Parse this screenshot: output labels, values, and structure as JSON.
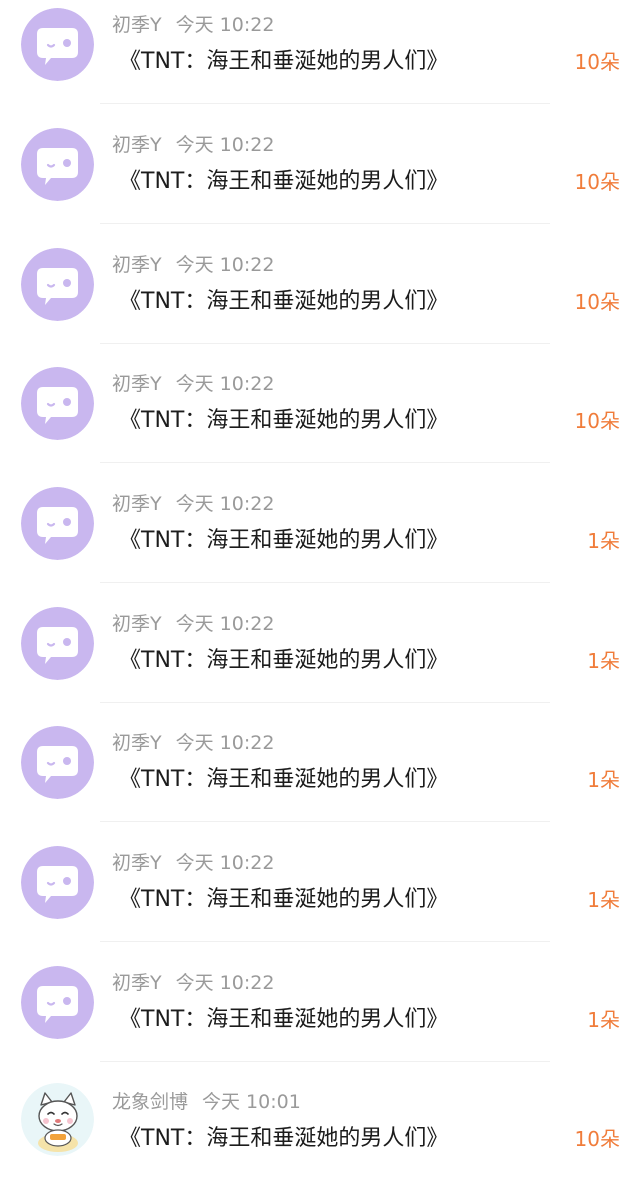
{
  "colors": {
    "avatar_purple": "#c9b7ef",
    "amount_orange": "#f07c3a",
    "meta_gray": "#9a9a9a",
    "title_black": "#1c1c1c"
  },
  "gifts": [
    {
      "user": "初季Y",
      "time": "今天 10:22",
      "title": "《TNT：海王和垂涎她的男人们》",
      "amount": "10朵",
      "avatar": "chat-bubble-icon"
    },
    {
      "user": "初季Y",
      "time": "今天 10:22",
      "title": "《TNT：海王和垂涎她的男人们》",
      "amount": "10朵",
      "avatar": "chat-bubble-icon"
    },
    {
      "user": "初季Y",
      "time": "今天 10:22",
      "title": "《TNT：海王和垂涎她的男人们》",
      "amount": "10朵",
      "avatar": "chat-bubble-icon"
    },
    {
      "user": "初季Y",
      "time": "今天 10:22",
      "title": "《TNT：海王和垂涎她的男人们》",
      "amount": "10朵",
      "avatar": "chat-bubble-icon"
    },
    {
      "user": "初季Y",
      "time": "今天 10:22",
      "title": "《TNT：海王和垂涎她的男人们》",
      "amount": "1朵",
      "avatar": "chat-bubble-icon"
    },
    {
      "user": "初季Y",
      "time": "今天 10:22",
      "title": "《TNT：海王和垂涎她的男人们》",
      "amount": "1朵",
      "avatar": "chat-bubble-icon"
    },
    {
      "user": "初季Y",
      "time": "今天 10:22",
      "title": "《TNT：海王和垂涎她的男人们》",
      "amount": "1朵",
      "avatar": "chat-bubble-icon"
    },
    {
      "user": "初季Y",
      "time": "今天 10:22",
      "title": "《TNT：海王和垂涎她的男人们》",
      "amount": "1朵",
      "avatar": "chat-bubble-icon"
    },
    {
      "user": "初季Y",
      "time": "今天 10:22",
      "title": "《TNT：海王和垂涎她的男人们》",
      "amount": "1朵",
      "avatar": "chat-bubble-icon"
    },
    {
      "user": "龙象剑博",
      "time": "今天 10:01",
      "title": "《TNT：海王和垂涎她的男人们》",
      "amount": "10朵",
      "avatar": "cartoon-cat-avatar"
    }
  ]
}
